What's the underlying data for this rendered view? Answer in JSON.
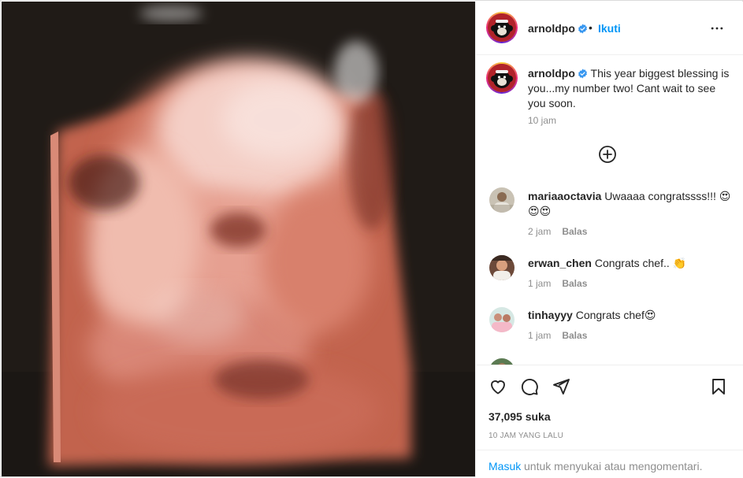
{
  "post": {
    "author": "arnoldpo",
    "follow_label": "Ikuti",
    "separator": "•",
    "more_icon": "more-horizontal-icon",
    "caption": "This year biggest blessing is you...my number two! Cant wait to see you soon.",
    "caption_time": "10 jam",
    "load_more_icon": "plus-circle-icon"
  },
  "comments": [
    {
      "user": "mariaaoctavia",
      "text": "Uwaaaa congratssss!!! 😍😍😍",
      "time": "2 jam",
      "reply": "Balas"
    },
    {
      "user": "erwan_chen",
      "text": "Congrats chef.. 👏",
      "time": "1 jam",
      "reply": "Balas"
    },
    {
      "user": "tinhayyy",
      "text": "Congrats chef😍",
      "time": "1 jam",
      "reply": "Balas"
    }
  ],
  "actions": {
    "like_icon": "heart-icon",
    "comment_icon": "comment-icon",
    "share_icon": "send-icon",
    "save_icon": "bookmark-icon",
    "likes": "37,095 suka",
    "posted_ago": "10 JAM YANG LALU"
  },
  "login": {
    "link": "Masuk",
    "rest": "untuk menyukai atau mengomentari."
  },
  "colors": {
    "accent": "#0095f6",
    "verified": "#3897f0",
    "muted": "#8e8e8e",
    "text": "#262626"
  }
}
